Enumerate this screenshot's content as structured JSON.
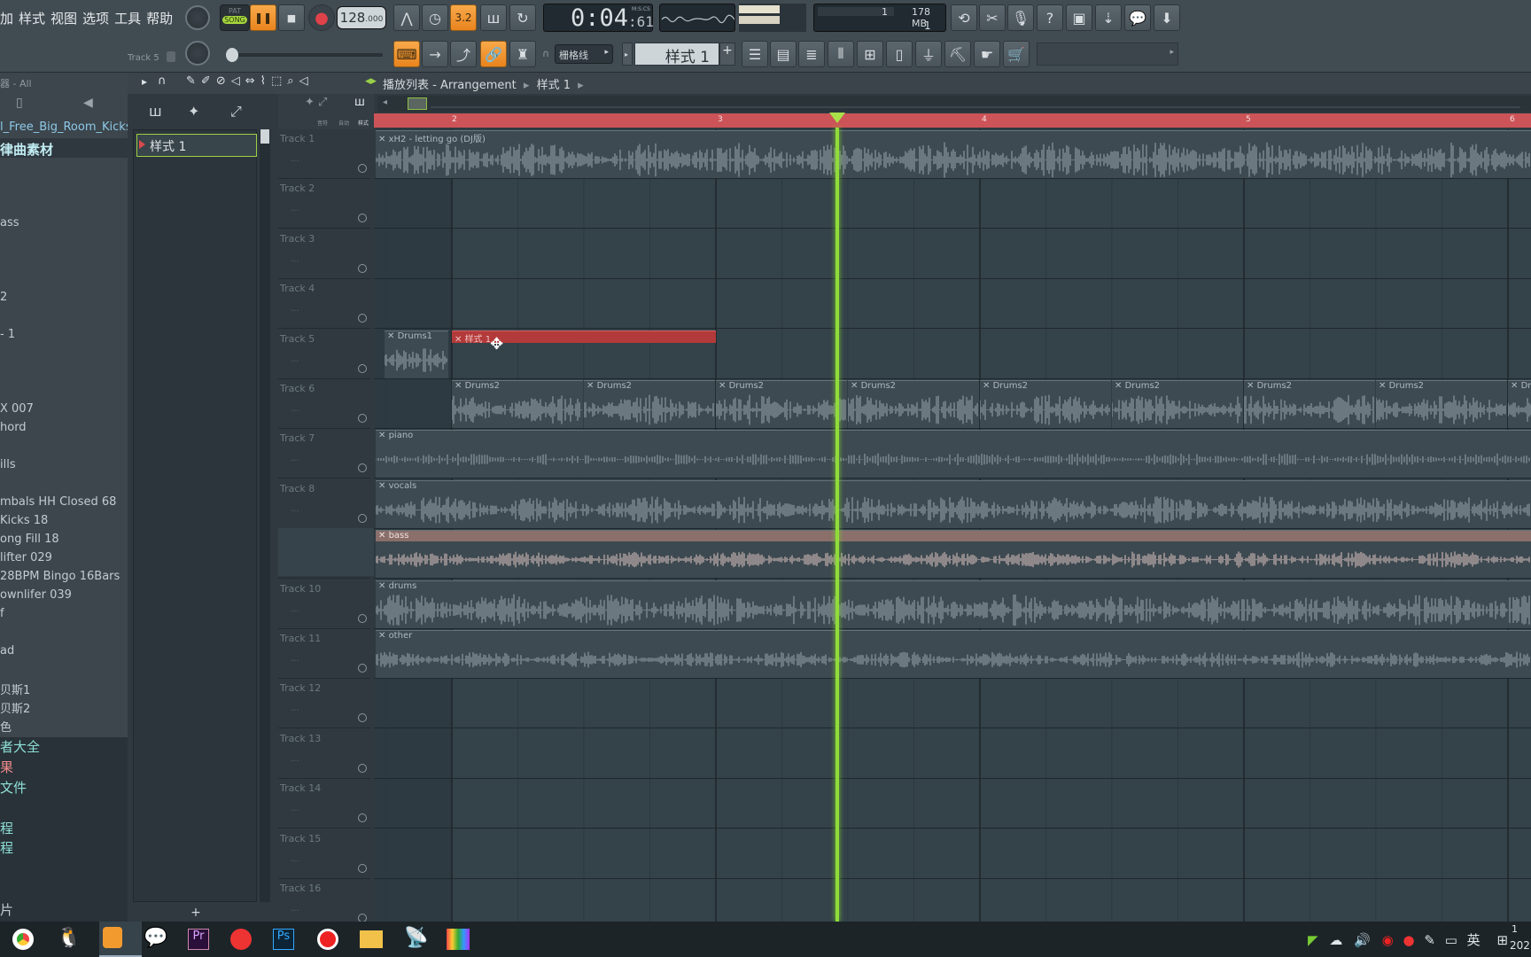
{
  "menu": [
    "加",
    "样式",
    "视图",
    "选项",
    "工具",
    "帮助"
  ],
  "transport": {
    "pat_label": "PAT",
    "song_label": "SONG",
    "tempo": "128",
    "tempo_frac": ".000",
    "time_main": "0:04",
    "time_sub": ":61",
    "time_format": "M:S:CS",
    "cpu_value": "1",
    "memory": "178 MB",
    "poly": "1"
  },
  "hint_bar": {
    "text": "Track 5"
  },
  "snap": {
    "label": "栅格线"
  },
  "pattern_selector": {
    "value": "样式 1",
    "add_label": "+"
  },
  "browser": {
    "header": "器 - All",
    "items": [
      "l_Free_Big_Room_Kicks",
      "律曲素材",
      "ass",
      "2",
      "- 1",
      "X 007",
      "hord",
      "ills",
      "mbals HH Closed 68",
      " Kicks 18",
      "ong Fill 18",
      "lifter 029",
      "28BPM Bingo 16Bars",
      "ownlifer 039",
      "f",
      "ad",
      "贝斯1",
      "贝斯2",
      "色",
      "者大全",
      "果",
      "文件",
      "程",
      "程",
      "片"
    ]
  },
  "playlist": {
    "title": "播放列表 - Arrangement",
    "crumb": "样式 1",
    "pattern_item": "样式 1",
    "add_label": "+",
    "ruler": [
      "2",
      "3",
      "4",
      "5",
      "6"
    ],
    "small_labels": [
      "音符",
      "自动",
      "样式"
    ],
    "tracks": [
      "Track 1",
      "Track 2",
      "Track 3",
      "Track 4",
      "Track 5",
      "Track 6",
      "Track 7",
      "Track 8",
      "Track 9",
      "Track 10",
      "Track 11",
      "Track 12",
      "Track 13",
      "Track 14",
      "Track 15",
      "Track 16"
    ],
    "clips": {
      "xh2": "xH2 - letting go (DJ版)",
      "drums1": "Drums1",
      "pattern": "样式 1",
      "drums2": "Drums2",
      "piano": "piano",
      "vocals": "vocals",
      "bass": "bass",
      "drums": "drums",
      "other": "other"
    }
  },
  "taskbar": {
    "ime": "英",
    "clock_partial": "202",
    "clock_top": "1"
  },
  "colors": {
    "accent_orange": "#f39a2f",
    "pattern_red": "#b33a3a",
    "playhead_green": "#8fdc3a",
    "bass_clip": "#8a6f6a"
  }
}
